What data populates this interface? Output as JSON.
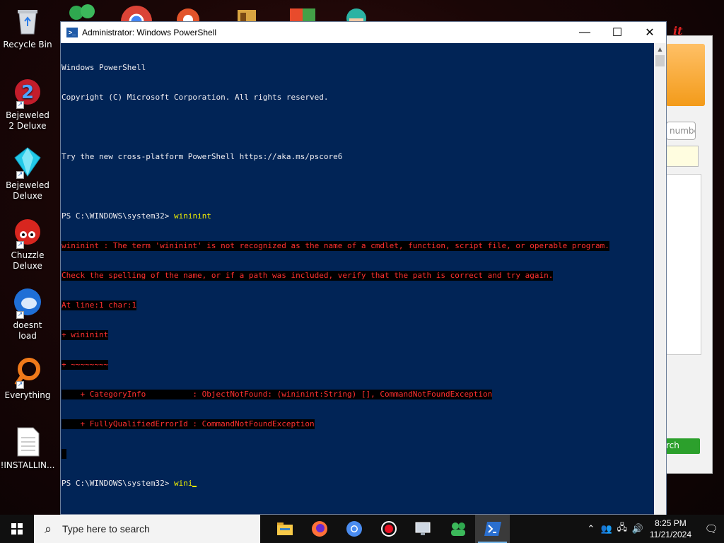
{
  "desktop": {
    "icons": [
      {
        "label": "Recycle Bin",
        "icon": "recycle-bin-icon"
      },
      {
        "label": "Bejeweled 2 Deluxe",
        "icon": "bejeweled2-icon"
      },
      {
        "label": "Bejeweled Deluxe",
        "icon": "bejeweled-icon"
      },
      {
        "label": "Chuzzle Deluxe",
        "icon": "chuzzle-icon"
      },
      {
        "label": "doesnt load",
        "icon": "thunderbird-icon"
      },
      {
        "label": "Everything",
        "icon": "everything-search-icon"
      },
      {
        "label": "!INSTALLIN...",
        "icon": "text-document-icon"
      }
    ]
  },
  "background_window": {
    "number_field_placeholder": "numbe",
    "search_button_label": "rch"
  },
  "powershell": {
    "title": "Administrator: Windows PowerShell",
    "lines": {
      "l1": "Windows PowerShell",
      "l2": "Copyright (C) Microsoft Corporation. All rights reserved.",
      "l3": "",
      "l4": "Try the new cross-platform PowerShell https://aka.ms/pscore6",
      "l5": "",
      "prompt1": "PS C:\\WINDOWS\\system32> ",
      "cmd1": "wininint",
      "e1": "wininint : The term 'wininint' is not recognized as the name of a cmdlet, function, script file, or operable program.",
      "e2": "Check the spelling of the name, or if a path was included, verify that the path is correct and try again.",
      "e3": "At line:1 char:1",
      "e4": "+ wininint",
      "e5": "+ ~~~~~~~~",
      "e6": "    + CategoryInfo          : ObjectNotFound: (wininint:String) [], CommandNotFoundException",
      "e7": "    + FullyQualifiedErrorId : CommandNotFoundException",
      "prompt2": "PS C:\\WINDOWS\\system32> ",
      "cmd2": "wini"
    }
  },
  "taskbar": {
    "search_placeholder": "Type here to search",
    "apps": [
      "file-explorer-icon",
      "firefox-icon",
      "chromium-icon",
      "record-icon",
      "remote-desktop-icon",
      "people-icon",
      "powershell-icon"
    ],
    "clock_time": "8:25 PM",
    "clock_date": "11/21/2024"
  },
  "colors": {
    "console_bg": "#012456",
    "console_fg": "#eeedf0",
    "error_fg": "#ff0000",
    "command_fg": "#f2f200"
  }
}
